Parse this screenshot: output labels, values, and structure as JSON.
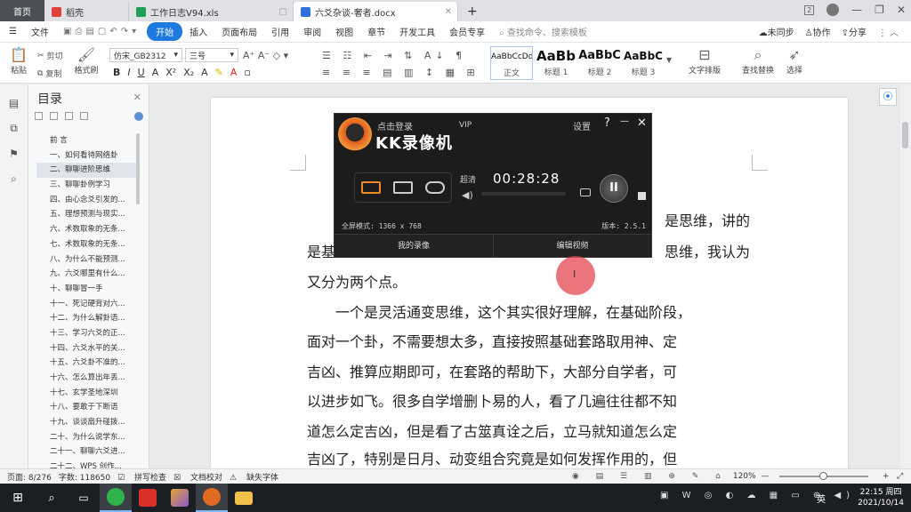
{
  "tabs": [
    {
      "label": "首页",
      "color": "#4a4f56"
    },
    {
      "label": "稻壳",
      "color": "#e0413c"
    },
    {
      "label": "工作日志V94.xls",
      "color": "#1e9f55"
    },
    {
      "label": "六爻杂谈-奢者.docx",
      "color": "#2f6fde"
    }
  ],
  "tab_add": "+",
  "window_badge": "2",
  "menu": [
    "文件",
    "开始",
    "插入",
    "页面布局",
    "引用",
    "审阅",
    "视图",
    "章节",
    "开发工具",
    "会员专享"
  ],
  "menu_search": "查找命令、搜索模板",
  "menu_right": [
    "未同步",
    "协作",
    "分享"
  ],
  "ribbon": {
    "paste": "粘贴",
    "cut": "剪切",
    "copy": "复制",
    "format_painter": "格式刷",
    "font_name": "仿宋_GB2312",
    "font_size": "三号",
    "styles": [
      {
        "sample": "AaBbCcDd",
        "name": "正文"
      },
      {
        "sample": "AaBb",
        "name": "标题 1"
      },
      {
        "sample": "AaBbC",
        "name": "标题 2"
      },
      {
        "sample": "AaBbC",
        "name": "标题 3"
      }
    ],
    "text_layout": "文字排版",
    "find_replace": "查找替换",
    "select": "选择"
  },
  "toc": {
    "title": "目录",
    "items": [
      "前 言",
      "一、如何看待网络卦",
      "二、聊聊进阶思维",
      "三、聊聊卦例学习",
      "四、由心念爻引发的...",
      "五、理想预测与现实...",
      "六、术数取象的无条...",
      "七、术数取象的无条...",
      "八、为什么不能预测...",
      "九、六爻哪里有什么...",
      "十、聊聊冒一手",
      "十一、死记硬背对六...",
      "十二、为什么解卦语...",
      "十三、学习六爻的正...",
      "十四、六爻水平的关...",
      "十五、六爻卦不准的...",
      "十六、怎么算出年丢...",
      "十七、玄学圣地深圳",
      "十八、要敢于下断语",
      "十九、谈谈扇升碰拨...",
      "二十、为什么说学东...",
      "二十一、聊聊六爻进...",
      "二十二、WPS 创作..."
    ],
    "selected_index": 2
  },
  "document": {
    "lines": [
      {
        "text": "是思维，讲的",
        "indent": false
      },
      {
        "text": "是基",
        "indent": false
      },
      {
        "text": "又分为两个点。",
        "indent": false
      },
      {
        "text": "一个是灵活通变思维，这个其实很好理解，在基础阶段，",
        "indent": true
      },
      {
        "text": "面对一个卦，不需要想太多，直接按照基础套路取用神、定",
        "indent": false
      },
      {
        "text": "吉凶、推算应期即可，在套路的帮助下，大部分自学者，可",
        "indent": false
      },
      {
        "text": "以进步如飞。很多自学增删卜易的人，看了几遍往往都不知",
        "indent": false
      },
      {
        "text": "道怎么定吉凶，但是看了古筮真诠之后，立马就知道怎么定",
        "indent": false
      },
      {
        "text": "吉凶了，特别是日月、动变组合究竟是如何发挥作用的，但",
        "indent": false
      }
    ],
    "line2_right": "思维，我认为"
  },
  "kk_recorder": {
    "login": "点击登录",
    "vip": "VIP",
    "title": "KK录像机",
    "settings": "设置",
    "help": "?",
    "minimize": "—",
    "close": "✕",
    "quality": "超清",
    "timer": "00:28:28",
    "pause": "II",
    "fullscreen_mode": "全屏模式: 1366 x 768",
    "version": "版本: 2.5.1",
    "my_recordings": "我的录像",
    "edit_video": "编辑视频",
    "volume_level": 0.0
  },
  "status_bar": {
    "page": "页面: 8/276",
    "words": "字数: 118650",
    "spell_check": "拼写检查",
    "doc_check": "文档校对",
    "missing_font": "缺失字体",
    "zoom": "120%",
    "zoom_minus": "—",
    "zoom_plus": "+"
  },
  "taskbar": {
    "time": "22:15 周四",
    "date": "2021/10/14",
    "ime": "英",
    "apps": [
      {
        "name": "app-green",
        "color": "#2fb34a"
      },
      {
        "name": "app-red",
        "color": "#d7312a"
      },
      {
        "name": "app-photo",
        "color": "#8a5ac7"
      },
      {
        "name": "app-kk",
        "color": "#e06a1f"
      },
      {
        "name": "app-folder",
        "color": "#f0c04a"
      }
    ]
  }
}
